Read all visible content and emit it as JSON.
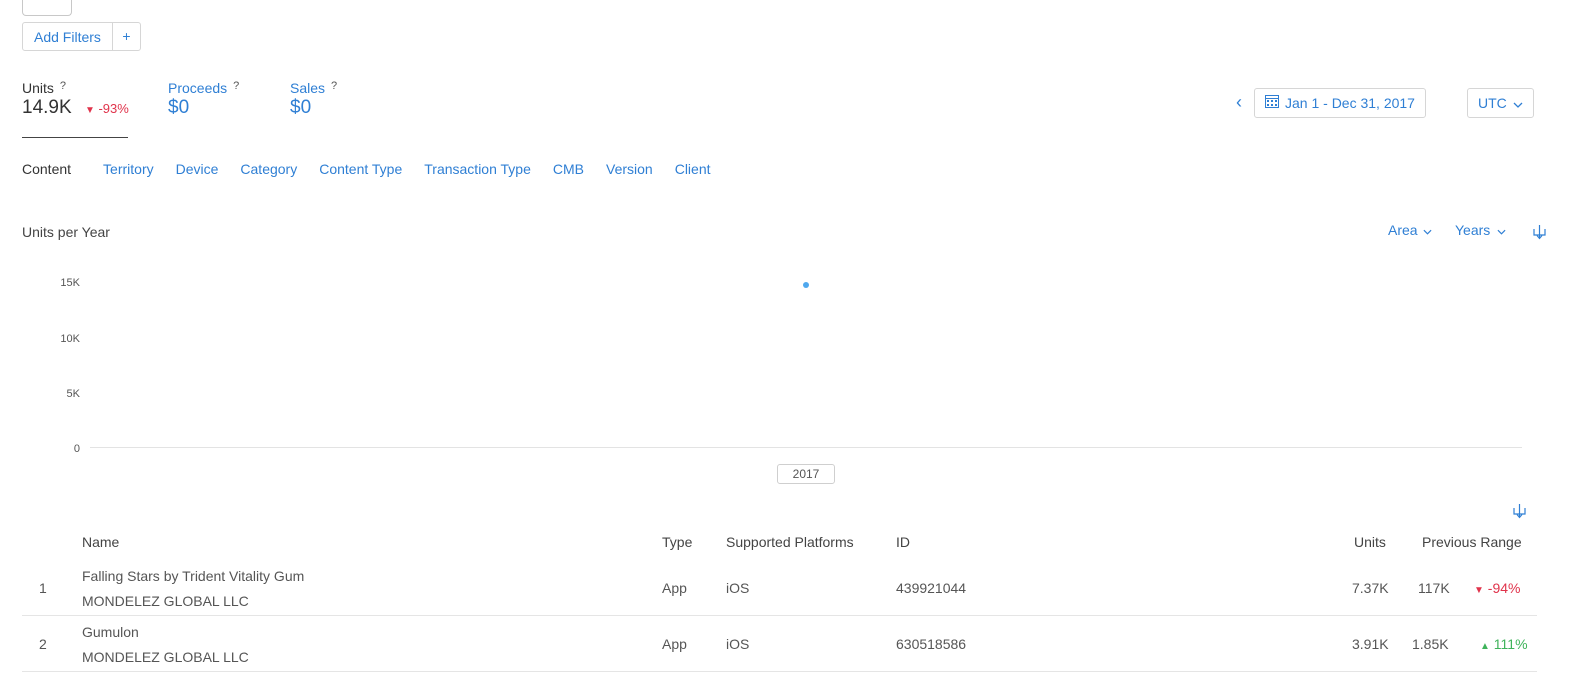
{
  "filters": {
    "add_label": "Add Filters",
    "plus": "+"
  },
  "metrics": [
    {
      "label": "Units",
      "help": "?",
      "value": "14.9K",
      "delta": "-93%",
      "delta_dir": "down"
    },
    {
      "label": "Proceeds",
      "help": "?",
      "value": "$0"
    },
    {
      "label": "Sales",
      "help": "?",
      "value": "$0"
    }
  ],
  "date_range": {
    "prev": "‹",
    "label": "Jan 1 - Dec 31, 2017"
  },
  "timezone": {
    "label": "UTC"
  },
  "tabs": [
    "Content",
    "Territory",
    "Device",
    "Category",
    "Content Type",
    "Transaction Type",
    "CMB",
    "Version",
    "Client"
  ],
  "chart_controls": {
    "chart_type": "Area",
    "period": "Years"
  },
  "chart_data": {
    "type": "area",
    "title": "Units per Year",
    "x": [
      "2017"
    ],
    "series": [
      {
        "values": [
          14900
        ]
      }
    ],
    "ylim": [
      0,
      15000
    ],
    "yticks": [
      "15K",
      "10K",
      "5K",
      "0"
    ],
    "grid": false,
    "point_color": "#4fa8ee"
  },
  "table": {
    "headers": {
      "name": "Name",
      "type": "Type",
      "platforms": "Supported Platforms",
      "id": "ID",
      "units": "Units",
      "previous": "Previous Range"
    },
    "rows": [
      {
        "rank": "1",
        "name": "Falling Stars by Trident Vitality Gum",
        "developer": "MONDELEZ GLOBAL LLC",
        "type": "App",
        "platforms": "iOS",
        "id": "439921044",
        "units": "7.37K",
        "previous": "117K",
        "change": "-94%",
        "change_dir": "down"
      },
      {
        "rank": "2",
        "name": "Gumulon",
        "developer": "MONDELEZ GLOBAL LLC",
        "type": "App",
        "platforms": "iOS",
        "id": "630518586",
        "units": "3.91K",
        "previous": "1.85K",
        "change": "111%",
        "change_dir": "up"
      }
    ]
  },
  "colors": {
    "accent": "#2f7fd4",
    "negative": "#e0334b",
    "positive": "#3fb35b"
  }
}
